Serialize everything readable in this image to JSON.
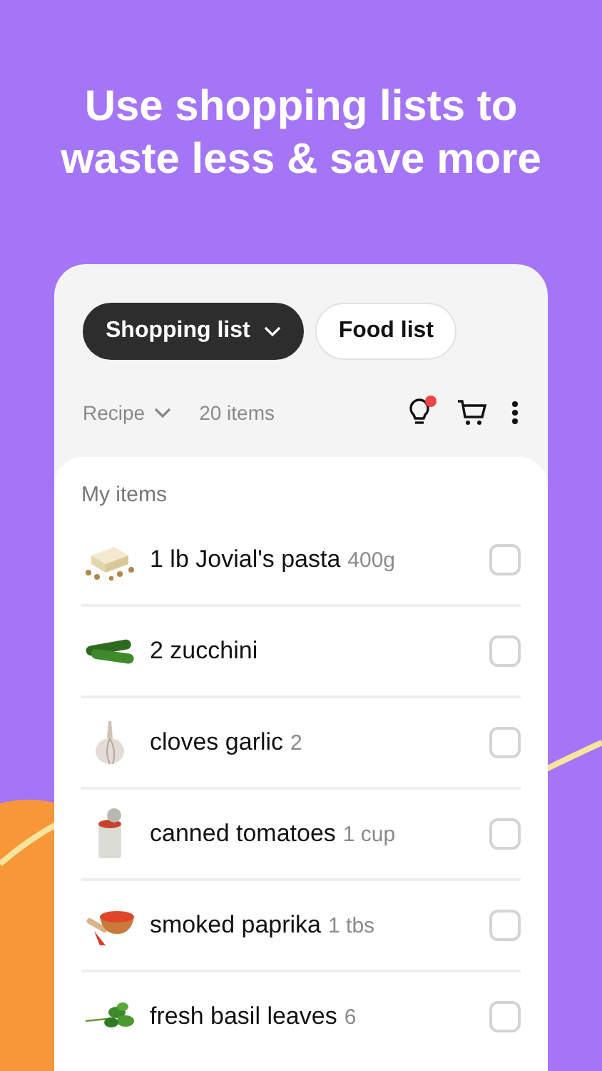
{
  "headline": "Use shopping lists to waste less & save more",
  "tabs": [
    {
      "label": "Shopping list",
      "selected": true,
      "dropdown": true
    },
    {
      "label": "Food list",
      "selected": false,
      "dropdown": false
    }
  ],
  "filter": {
    "label": "Recipe",
    "count": "20 items"
  },
  "notification_dot": true,
  "section_title": "My items",
  "items": [
    {
      "name": "1 lb Jovial's pasta",
      "amount": "400g",
      "checked": false
    },
    {
      "name": "2 zucchini",
      "checked": false
    },
    {
      "name": "cloves garlic",
      "amount": "2",
      "checked": false
    },
    {
      "name": "canned tomatoes",
      "amount": "1 cup",
      "checked": false
    },
    {
      "name": "smoked paprika",
      "amount": "1 tbs",
      "checked": false
    },
    {
      "name": "fresh basil leaves",
      "amount": "6",
      "checked": false
    }
  ]
}
